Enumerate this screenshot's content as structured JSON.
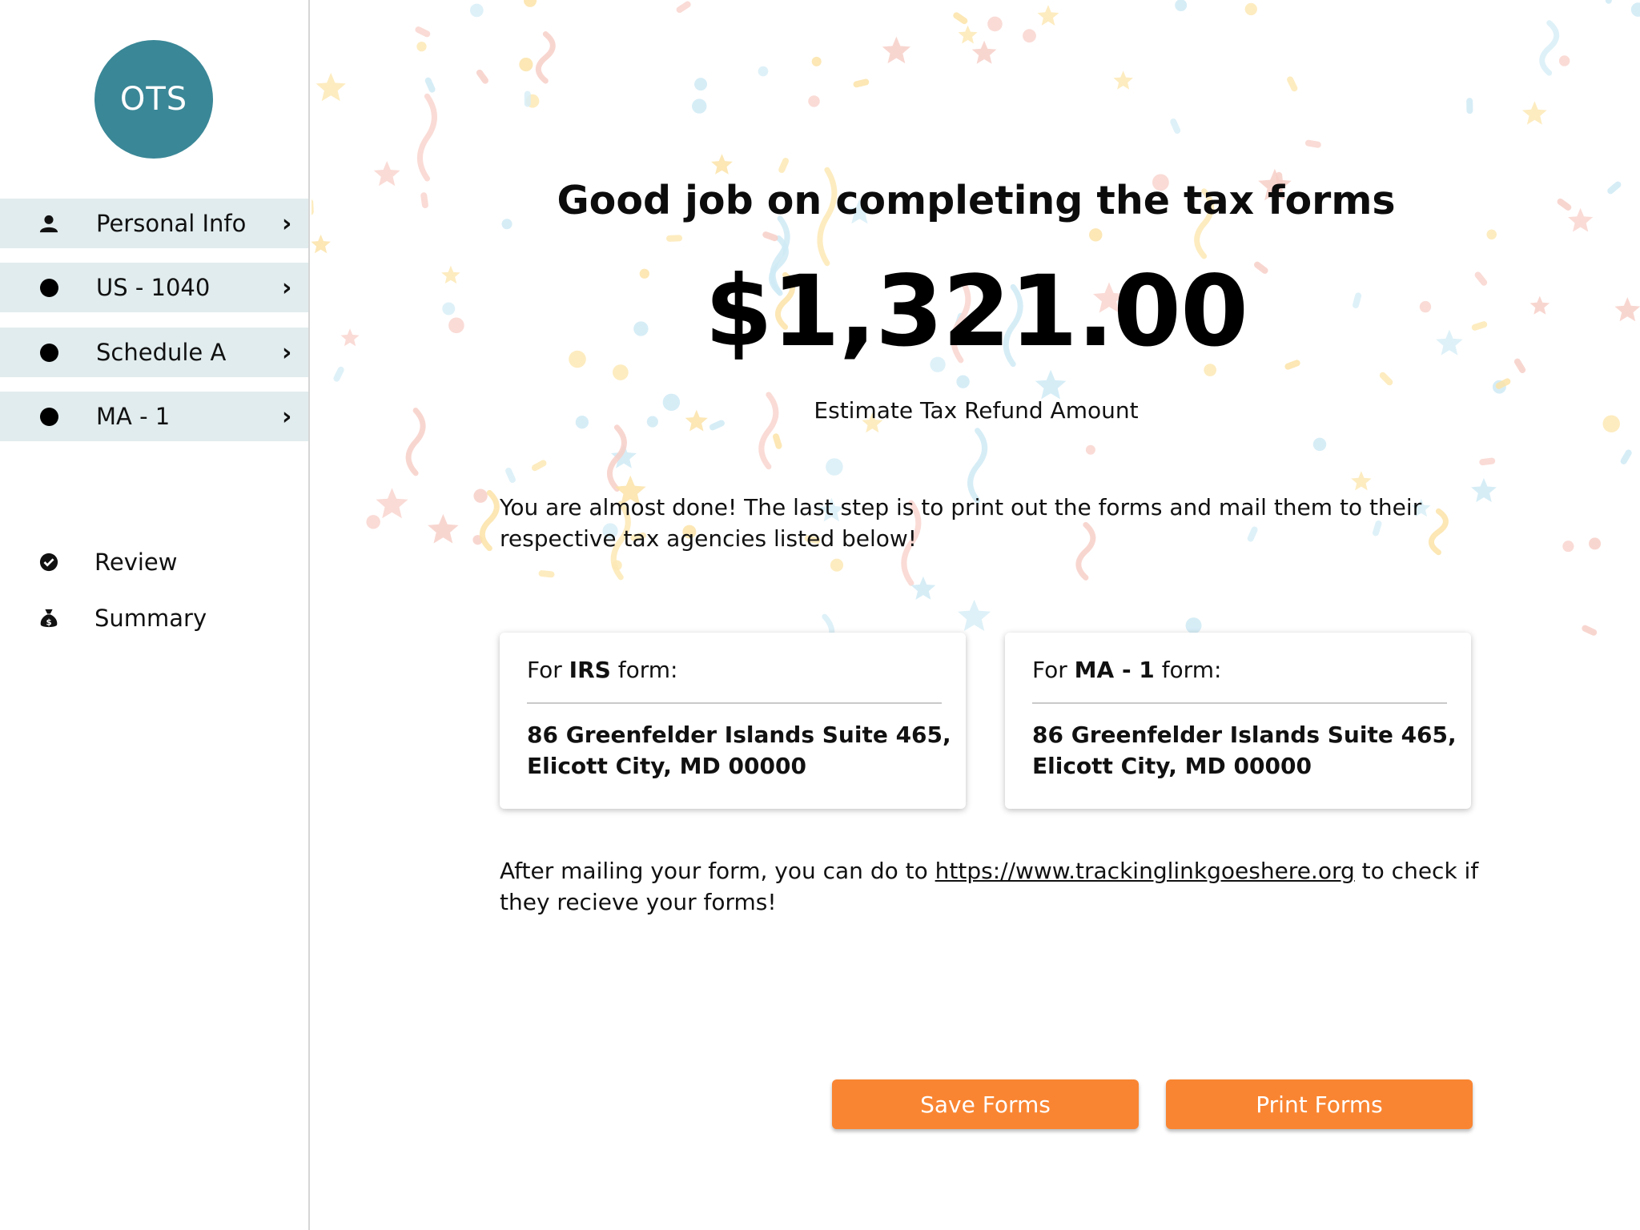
{
  "app": {
    "logo_text": "OTS"
  },
  "sidebar": {
    "items": [
      {
        "label": "Personal Info",
        "icon": "user-icon"
      },
      {
        "label": "US - 1040",
        "icon": "dot-icon"
      },
      {
        "label": "Schedule A",
        "icon": "dot-icon"
      },
      {
        "label": "MA - 1",
        "icon": "dot-icon"
      }
    ],
    "links": [
      {
        "label": "Review",
        "icon": "check-circle-icon"
      },
      {
        "label": "Summary",
        "icon": "money-bag-icon"
      }
    ]
  },
  "main": {
    "headline": "Good job on completing the tax forms",
    "amount": "$1,321.00",
    "amount_label": "Estimate Tax Refund Amount",
    "intro": "You are almost done! The last step is to print out the forms and mail them to their respective tax agencies listed below!",
    "cards": [
      {
        "prefix": "For",
        "agency": "IRS",
        "suffix": "form:",
        "address_line1": "86 Greenfelder Islands Suite 465,",
        "address_line2": "Elicott City, MD 00000"
      },
      {
        "prefix": "For",
        "agency": "MA - 1",
        "suffix": " form:",
        "address_line1": "86 Greenfelder Islands Suite 465,",
        "address_line2": "Elicott City, MD 00000"
      }
    ],
    "after_text_before": "After mailing your form, you can do to",
    "tracking_link": "https://www.trackinglinkgoeshere.org",
    "after_text_after": "to check if they recieve your forms!",
    "save_button": "Save Forms",
    "print_button": "Print Forms"
  },
  "colors": {
    "accent_orange": "#f98532",
    "logo_teal": "#3a8797",
    "nav_background": "#e1ecee"
  }
}
